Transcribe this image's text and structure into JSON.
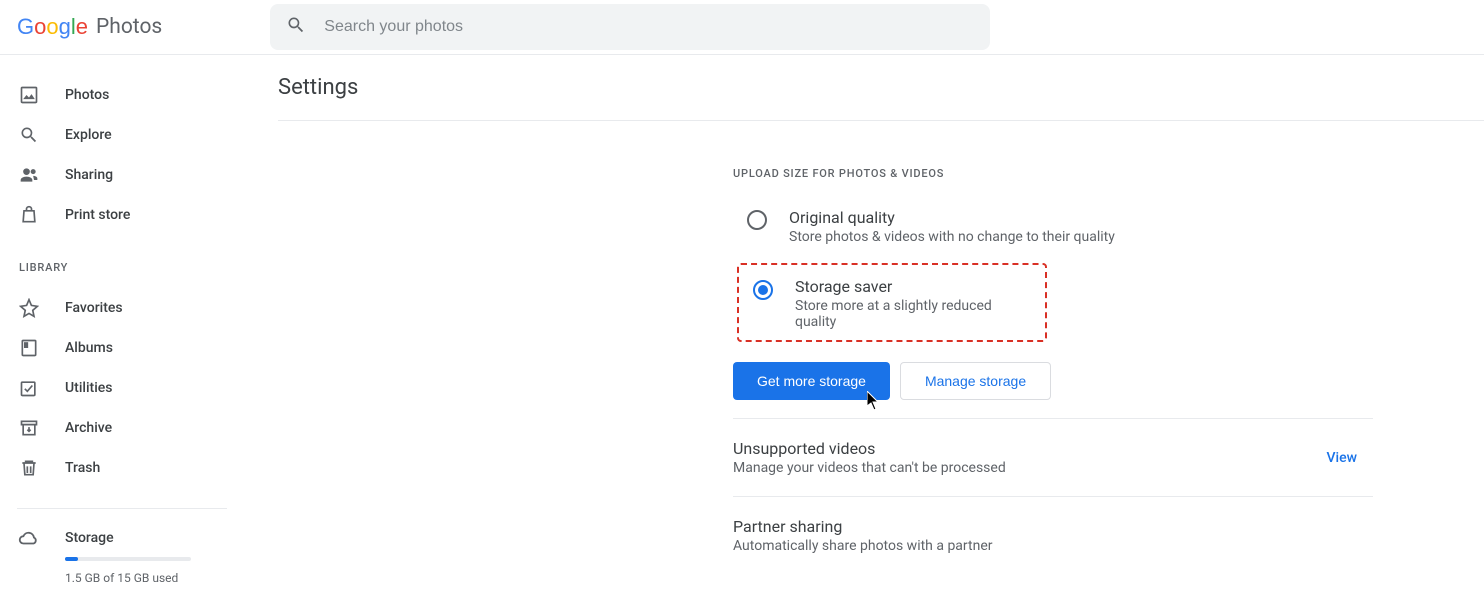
{
  "header": {
    "brand_prefix": "Google",
    "brand_suffix": "Photos",
    "search_placeholder": "Search your photos"
  },
  "sidebar": {
    "nav": [
      {
        "label": "Photos",
        "icon": "photo-icon"
      },
      {
        "label": "Explore",
        "icon": "search-icon"
      },
      {
        "label": "Sharing",
        "icon": "people-icon"
      },
      {
        "label": "Print store",
        "icon": "bag-icon"
      }
    ],
    "library_header": "LIBRARY",
    "library": [
      {
        "label": "Favorites",
        "icon": "star-icon"
      },
      {
        "label": "Albums",
        "icon": "album-icon"
      },
      {
        "label": "Utilities",
        "icon": "check-icon"
      },
      {
        "label": "Archive",
        "icon": "archive-icon"
      },
      {
        "label": "Trash",
        "icon": "trash-icon"
      }
    ],
    "storage": {
      "label": "Storage",
      "percent": 10,
      "text": "1.5 GB of 15 GB used"
    }
  },
  "main": {
    "title": "Settings",
    "section_label": "UPLOAD SIZE FOR PHOTOS & VIDEOS",
    "options": {
      "original": {
        "title": "Original quality",
        "desc": "Store photos & videos with no change to their quality",
        "selected": false
      },
      "saver": {
        "title": "Storage saver",
        "desc": "Store more at a slightly reduced quality",
        "selected": true
      }
    },
    "buttons": {
      "primary": "Get more storage",
      "secondary": "Manage storage"
    },
    "rows": {
      "unsupported": {
        "title": "Unsupported videos",
        "desc": "Manage your videos that can't be processed",
        "action": "View"
      },
      "partner": {
        "title": "Partner sharing",
        "desc": "Automatically share photos with a partner"
      }
    }
  }
}
